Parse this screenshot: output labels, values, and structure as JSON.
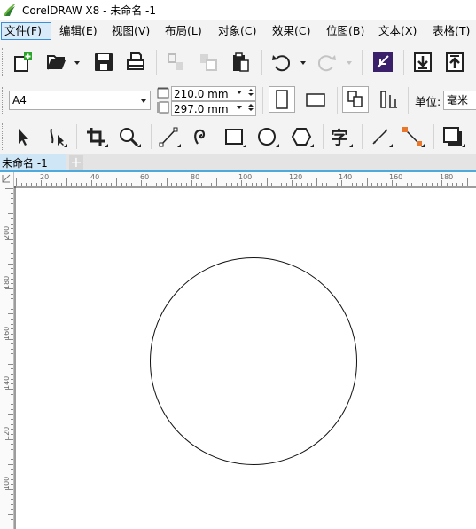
{
  "window": {
    "title": "CorelDRAW X8 - 未命名 -1"
  },
  "menu": {
    "items": [
      {
        "label": "文件(F)",
        "active": true
      },
      {
        "label": "编辑(E)",
        "active": false
      },
      {
        "label": "视图(V)",
        "active": false
      },
      {
        "label": "布局(L)",
        "active": false
      },
      {
        "label": "对象(C)",
        "active": false
      },
      {
        "label": "效果(C)",
        "active": false
      },
      {
        "label": "位图(B)",
        "active": false
      },
      {
        "label": "文本(X)",
        "active": false
      },
      {
        "label": "表格(T)",
        "active": false
      }
    ]
  },
  "property_bar": {
    "page_size": "A4",
    "width": "210.0 mm",
    "height": "297.0 mm",
    "units_label": "单位:",
    "units_value": "毫米"
  },
  "document": {
    "tab_label": "未命名 -1",
    "new_tab_symbol": "+"
  },
  "rulers": {
    "horizontal_labels": [
      "20",
      "40",
      "60",
      "80",
      "100",
      "120",
      "140",
      "160",
      "180"
    ],
    "vertical_labels": [
      "200",
      "180",
      "160",
      "140",
      "120",
      "100"
    ]
  },
  "colors": {
    "accent": "#4fa9dd",
    "toolbar_bg": "#f3f3f3",
    "active_menu": "#d9ebf9"
  }
}
